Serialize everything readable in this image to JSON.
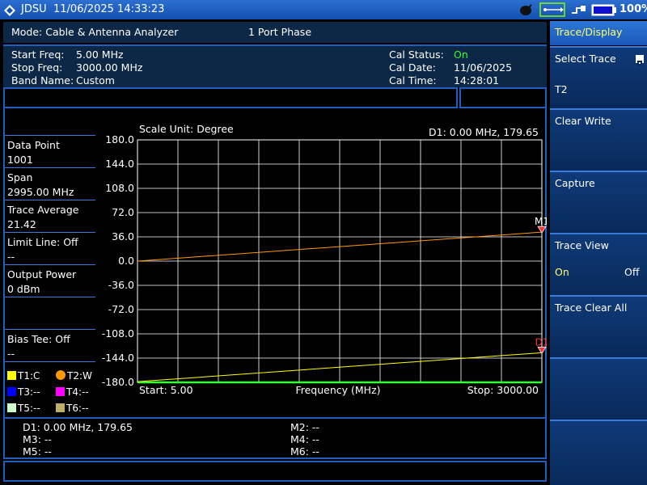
{
  "status_bar": {
    "brand": "JDSU",
    "datetime": "11/06/2025 14:33:23",
    "battery": "100%"
  },
  "mode_bar": {
    "mode": "Mode: Cable & Antenna Analyzer",
    "measurement": "1 Port Phase"
  },
  "params": {
    "start_label": "Start Freq:",
    "start_value": "5.00 MHz",
    "stop_label": "Stop Freq:",
    "stop_value": "3000.00 MHz",
    "band_label": "Band Name:",
    "band_value": "Custom",
    "cal_status_label": "Cal Status:",
    "cal_status_value": "On",
    "cal_date_label": "Cal Date:",
    "cal_date_value": "11/06/2025",
    "cal_time_label": "Cal Time:",
    "cal_time_value": "14:28:01"
  },
  "left_panel": {
    "data_point_label": "Data Point",
    "data_point_value": "1001",
    "span_label": "Span",
    "span_value": "2995.00 MHz",
    "trace_avg_label": "Trace Average",
    "trace_avg_value": "21.42",
    "limit_label": "Limit Line: Off",
    "limit_value": "--",
    "output_label": "Output Power",
    "output_value": "0 dBm",
    "bias_label": "Bias Tee: Off",
    "bias_value": "--",
    "legend": [
      {
        "text": "T1:C",
        "color": "#ffff00"
      },
      {
        "text": "T2:W",
        "color": "#ff9900"
      },
      {
        "text": "T3:--",
        "color": "#0000ff"
      },
      {
        "text": "T4:--",
        "color": "#ff00ff"
      },
      {
        "text": "T5:--",
        "color": "#ccffcc"
      },
      {
        "text": "T6:--",
        "color": "#bfae66"
      }
    ]
  },
  "chart_data": {
    "type": "line",
    "scale_unit": "Scale Unit: Degree",
    "delta_readout": "D1: 0.00 MHz, 179.65",
    "xlabel": "Frequency (MHz)",
    "start_label": "Start: 5.00",
    "stop_label": "Stop: 3000.00",
    "x_range": [
      5,
      3000
    ],
    "ylim": [
      -180,
      180
    ],
    "y_ticks": [
      "180.0",
      "144.0",
      "108.0",
      "72.0",
      "36.0",
      "0.0",
      "-36.0",
      "-72.0",
      "-108.0",
      "-144.0",
      "-180.0"
    ],
    "series": [
      {
        "name": "T2",
        "color": "#ff9900",
        "x": [
          5,
          3000
        ],
        "y": [
          0,
          43
        ]
      },
      {
        "name": "T1",
        "color": "#ffff00",
        "x": [
          5,
          3000
        ],
        "y": [
          -179,
          -136
        ]
      }
    ],
    "markers": [
      {
        "label": "M1",
        "x": 3000,
        "y": 43
      },
      {
        "label": "D1",
        "x": 3000,
        "y": -136
      }
    ],
    "grid": true
  },
  "marker_table": {
    "d1": "D1: 0.00 MHz, 179.65",
    "m2": "M2: --",
    "m3": "M3: --",
    "m4": "M4: --",
    "m5": "M5: --",
    "m6": "M6: --"
  },
  "softkeys": {
    "title": "Trace/Display",
    "select_trace": "Select Trace",
    "select_trace_value": "T2",
    "clear_write": "Clear Write",
    "capture": "Capture",
    "trace_view": "Trace View",
    "trace_view_on": "On",
    "trace_view_off": "Off",
    "trace_clear_all": "Trace Clear All"
  }
}
